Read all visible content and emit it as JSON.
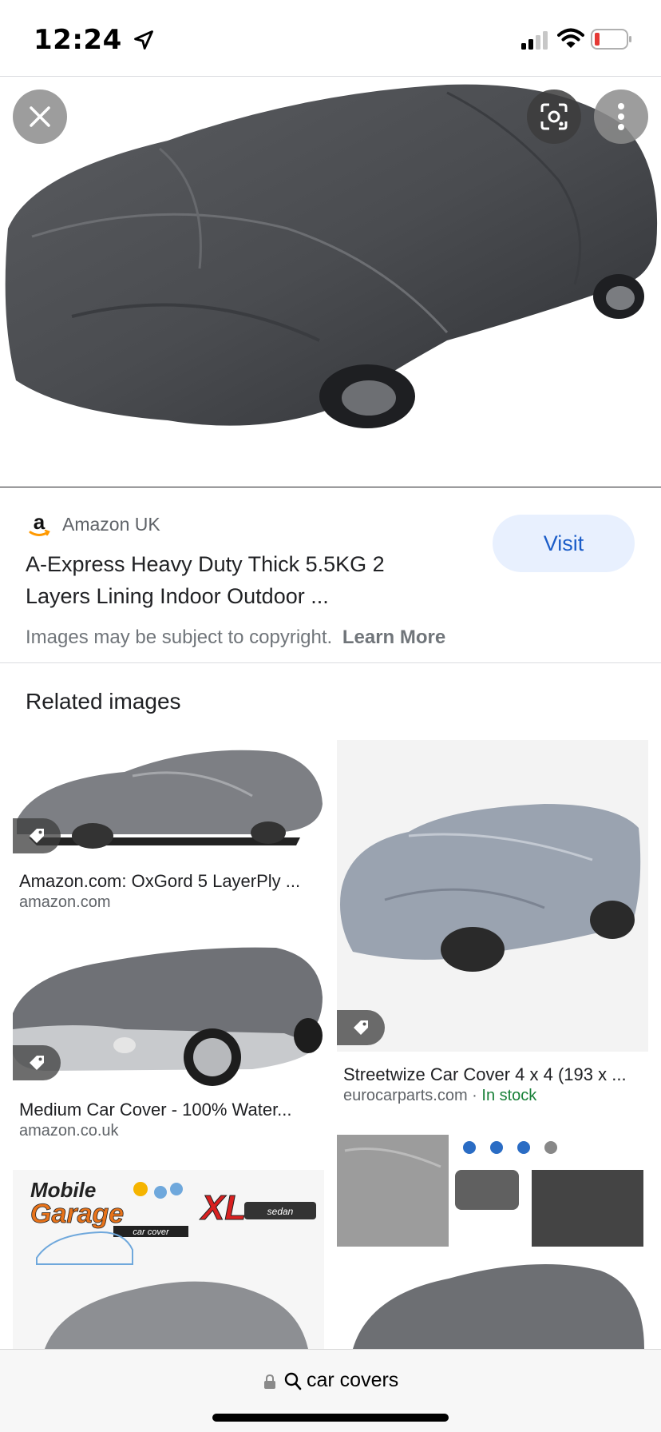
{
  "status_bar": {
    "time": "12:24",
    "icons": [
      "location-arrow-icon",
      "cellular-signal-icon",
      "wifi-icon",
      "battery-low-icon"
    ],
    "battery_color": "#e53935"
  },
  "viewer": {
    "buttons": [
      "close-icon",
      "lens-icon",
      "more-vert-icon"
    ]
  },
  "result": {
    "source": "Amazon UK",
    "title_line1": "A-Express Heavy Duty Thick 5.5KG 2",
    "title_line2": "Layers Lining Indoor Outdoor ...",
    "visit_label": "Visit",
    "copyright_text": "Images may be subject to copyright.",
    "learn_more": "Learn More"
  },
  "related": {
    "heading": "Related images",
    "items": [
      {
        "title": "Amazon.com: OxGord 5 LayerPly ...",
        "source": "amazon.com",
        "stock": ""
      },
      {
        "title": "Streetwize Car Cover 4 x 4 (193 x ...",
        "source": "eurocarparts.com · ",
        "stock": "In stock"
      },
      {
        "title": "Medium Car Cover - 100% Water...",
        "source": "amazon.co.uk",
        "stock": ""
      },
      {
        "title": "",
        "source": "",
        "stock": ""
      },
      {
        "title": "",
        "source": "",
        "stock": ""
      }
    ],
    "mobile_garage": {
      "brand_line1": "Mobile",
      "brand_line2": "Garage",
      "brand_sub": "car cover",
      "size": "XL",
      "type": "sedan"
    }
  },
  "address_bar": {
    "query": "car covers"
  },
  "colors": {
    "accent": "#1a5cc8",
    "visit_bg": "#e8f0fe",
    "in_stock": "#188038"
  }
}
